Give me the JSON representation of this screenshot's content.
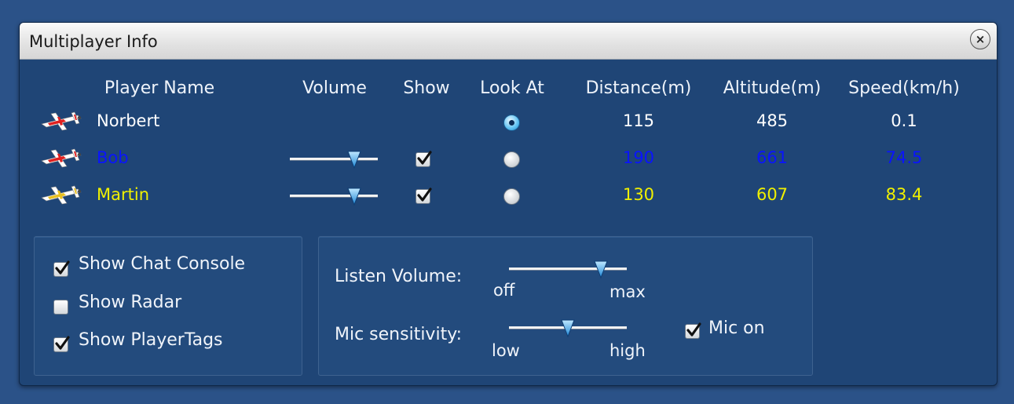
{
  "window": {
    "title": "Multiplayer Info"
  },
  "columns": {
    "player_name": "Player Name",
    "volume": "Volume",
    "show": "Show",
    "look_at": "Look At",
    "distance": "Distance(m)",
    "altitude": "Altitude(m)",
    "speed": "Speed(km/h)"
  },
  "players": [
    {
      "name": "Norbert",
      "color": "#ffffff",
      "plane_color": "#e02020",
      "distance": "115",
      "altitude": "485",
      "speed": "0.1",
      "look_at": true,
      "show": null,
      "volume": null
    },
    {
      "name": "Bob",
      "color": "#0a14ff",
      "plane_color": "#e02020",
      "distance": "190",
      "altitude": "661",
      "speed": "74.5",
      "look_at": false,
      "show": true,
      "volume": 0.78
    },
    {
      "name": "Martin",
      "color": "#f0f000",
      "plane_color": "#e8c020",
      "distance": "130",
      "altitude": "607",
      "speed": "83.4",
      "look_at": false,
      "show": true,
      "volume": 0.78
    }
  ],
  "options": {
    "show_chat_console": {
      "label": "Show Chat Console",
      "checked": true
    },
    "show_radar": {
      "label": "Show Radar",
      "checked": false
    },
    "show_player_tags": {
      "label": "Show PlayerTags",
      "checked": true
    }
  },
  "audio": {
    "listen_volume_label": "Listen Volume:",
    "listen_min": "off",
    "listen_max": "max",
    "listen_value": 0.82,
    "mic_sensitivity_label": "Mic sensitivity:",
    "mic_min": "low",
    "mic_max": "high",
    "mic_value": 0.5,
    "mic_on": {
      "label": "Mic on",
      "checked": true
    }
  },
  "icons": {
    "close": "close-icon",
    "plane": "airplane-icon",
    "check": "checkmark-icon",
    "slider_thumb": "slider-thumb-icon"
  }
}
